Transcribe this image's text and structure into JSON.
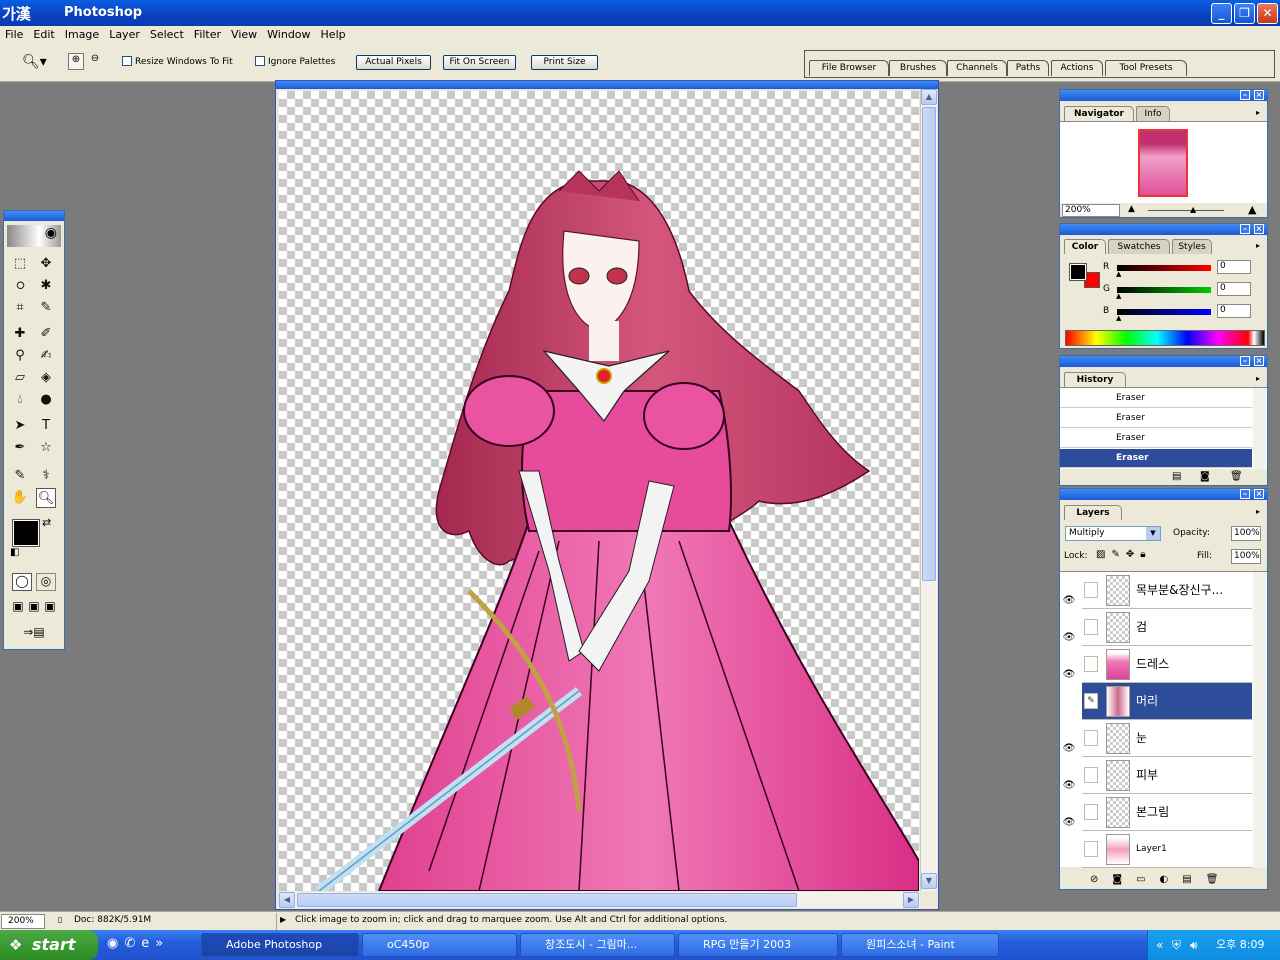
{
  "app": {
    "ime_label": "가漢",
    "title": "Photoshop"
  },
  "menu": [
    "File",
    "Edit",
    "Image",
    "Layer",
    "Select",
    "Filter",
    "View",
    "Window",
    "Help"
  ],
  "options_bar": {
    "resize_windows": "Resize Windows To Fit",
    "ignore_palettes": "Ignore Palettes",
    "actual_pixels": "Actual Pixels",
    "fit_on_screen": "Fit On Screen",
    "print_size": "Print Size"
  },
  "palette_well": [
    "File Browser",
    "Brushes",
    "Channels",
    "Paths",
    "Actions",
    "Tool Presets"
  ],
  "navigator": {
    "tabs": [
      "Navigator",
      "Info"
    ],
    "zoom": "200%"
  },
  "color_panel": {
    "tabs": [
      "Color",
      "Swatches",
      "Styles"
    ],
    "r_label": "R",
    "r_value": "0",
    "g_label": "G",
    "g_value": "0",
    "b_label": "B",
    "b_value": "0",
    "fg_color": "#000000",
    "bg_color": "#ff0000"
  },
  "history": {
    "title": "History",
    "items": [
      "Eraser",
      "Eraser",
      "Eraser",
      "Eraser"
    ]
  },
  "layers": {
    "title": "Layers",
    "blend_mode": "Multiply",
    "opacity_label": "Opacity:",
    "opacity": "100%",
    "lock_label": "Lock:",
    "fill_label": "Fill:",
    "fill": "100%",
    "items": [
      "목부분&장신구...",
      "검",
      "드레스",
      "머리",
      "눈",
      "피부",
      "본그림",
      "Layer1"
    ]
  },
  "status": {
    "zoom": "200%",
    "doc": "Doc: 882K/5.91M",
    "hint": "Click image to zoom in; click and drag to marquee zoom.  Use Alt and Ctrl for additional options."
  },
  "taskbar": {
    "start": "start",
    "tasks": [
      "Adobe Photoshop",
      "oC450p",
      "창조도시 - 그림마...",
      "RPG 만들기 2003",
      "원피스소녀 - Paint"
    ],
    "clock": "오후 8:09"
  }
}
